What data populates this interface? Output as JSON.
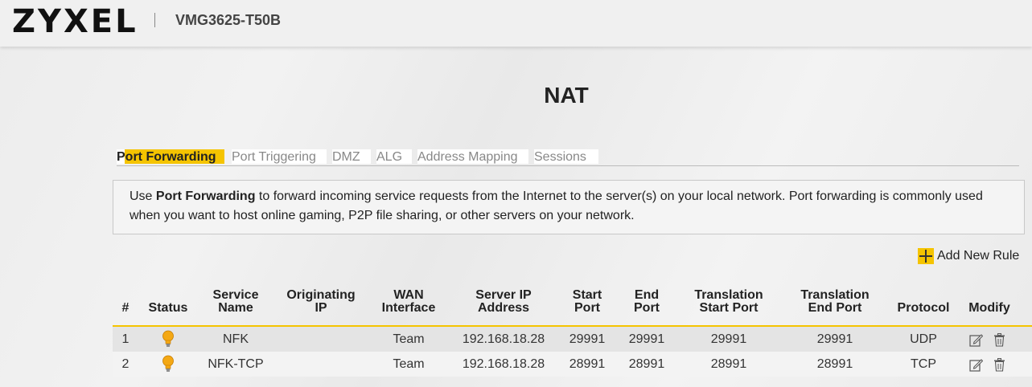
{
  "header": {
    "brand": "ZYXEL",
    "model": "VMG3625-T50B"
  },
  "page": {
    "title": "NAT"
  },
  "tabs": [
    "Port Forwarding",
    "Port Triggering",
    "DMZ",
    "ALG",
    "Address Mapping",
    "Sessions"
  ],
  "active_tab": "Port Forwarding",
  "description": {
    "prefix": "Use ",
    "bold": "Port Forwarding",
    "line1_rest": " to forward incoming service requests from the Internet to the server(s) on your local network. Port forwarding is commonly used",
    "line2": "when you want to host online gaming, P2P file sharing, or other servers on your network."
  },
  "add_rule_label": "Add New Rule",
  "columns": {
    "num": "#",
    "status": "Status",
    "service_1": "Service",
    "service_2": "Name",
    "orig_1": "Originating",
    "orig_2": "IP",
    "wan_1": "WAN",
    "wan_2": "Interface",
    "server_1": "Server IP",
    "server_2": "Address",
    "start_1": "Start",
    "start_2": "Port",
    "end_1": "End",
    "end_2": "Port",
    "tstart_1": "Translation",
    "tstart_2": "Start Port",
    "tend_1": "Translation",
    "tend_2": "End Port",
    "protocol": "Protocol",
    "modify": "Modify"
  },
  "rows": [
    {
      "num": "1",
      "status": "bulb-icon",
      "service": "NFK",
      "orig_ip": "",
      "wan": "Team",
      "server_ip": "192.168.18.28",
      "start": "29991",
      "end": "29991",
      "t_start": "29991",
      "t_end": "29991",
      "protocol": "UDP"
    },
    {
      "num": "2",
      "status": "bulb-icon",
      "service": "NFK-TCP",
      "orig_ip": "",
      "wan": "Team",
      "server_ip": "192.168.18.28",
      "start": "28991",
      "end": "28991",
      "t_start": "28991",
      "t_end": "28991",
      "protocol": "TCP"
    }
  ],
  "colors": {
    "accent": "#f5c400",
    "bulb": "#f4a814"
  }
}
